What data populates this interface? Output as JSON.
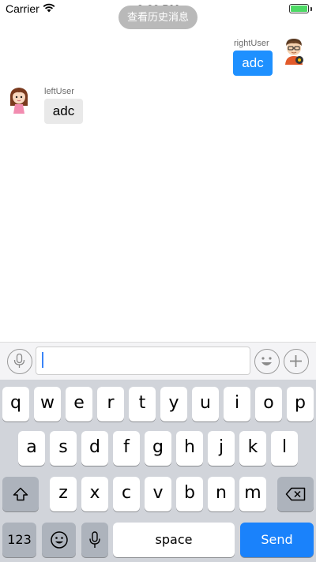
{
  "status_bar": {
    "carrier": "Carrier",
    "time": "3:33 PM"
  },
  "history_button": {
    "label": "查看历史消息"
  },
  "messages": [
    {
      "side": "right",
      "user": "rightUser",
      "text": "adc"
    },
    {
      "side": "left",
      "user": "leftUser",
      "text": "adc"
    }
  ],
  "input_bar": {
    "value": ""
  },
  "keyboard": {
    "row1": [
      "q",
      "w",
      "e",
      "r",
      "t",
      "y",
      "u",
      "i",
      "o",
      "p"
    ],
    "row2": [
      "a",
      "s",
      "d",
      "f",
      "g",
      "h",
      "j",
      "k",
      "l"
    ],
    "row3": [
      "z",
      "x",
      "c",
      "v",
      "b",
      "n",
      "m"
    ],
    "numbers_key": "123",
    "space_key": "space",
    "send_key": "Send"
  },
  "colors": {
    "accent": "#1a82fb",
    "bubble_right": "#1e90ff",
    "bubble_left": "#e9e9e9"
  },
  "icons": [
    "wifi-icon",
    "battery-icon",
    "voice-icon",
    "emoji-icon",
    "plus-icon",
    "shift-icon",
    "backspace-icon",
    "emoji-key-icon",
    "mic-key-icon"
  ]
}
